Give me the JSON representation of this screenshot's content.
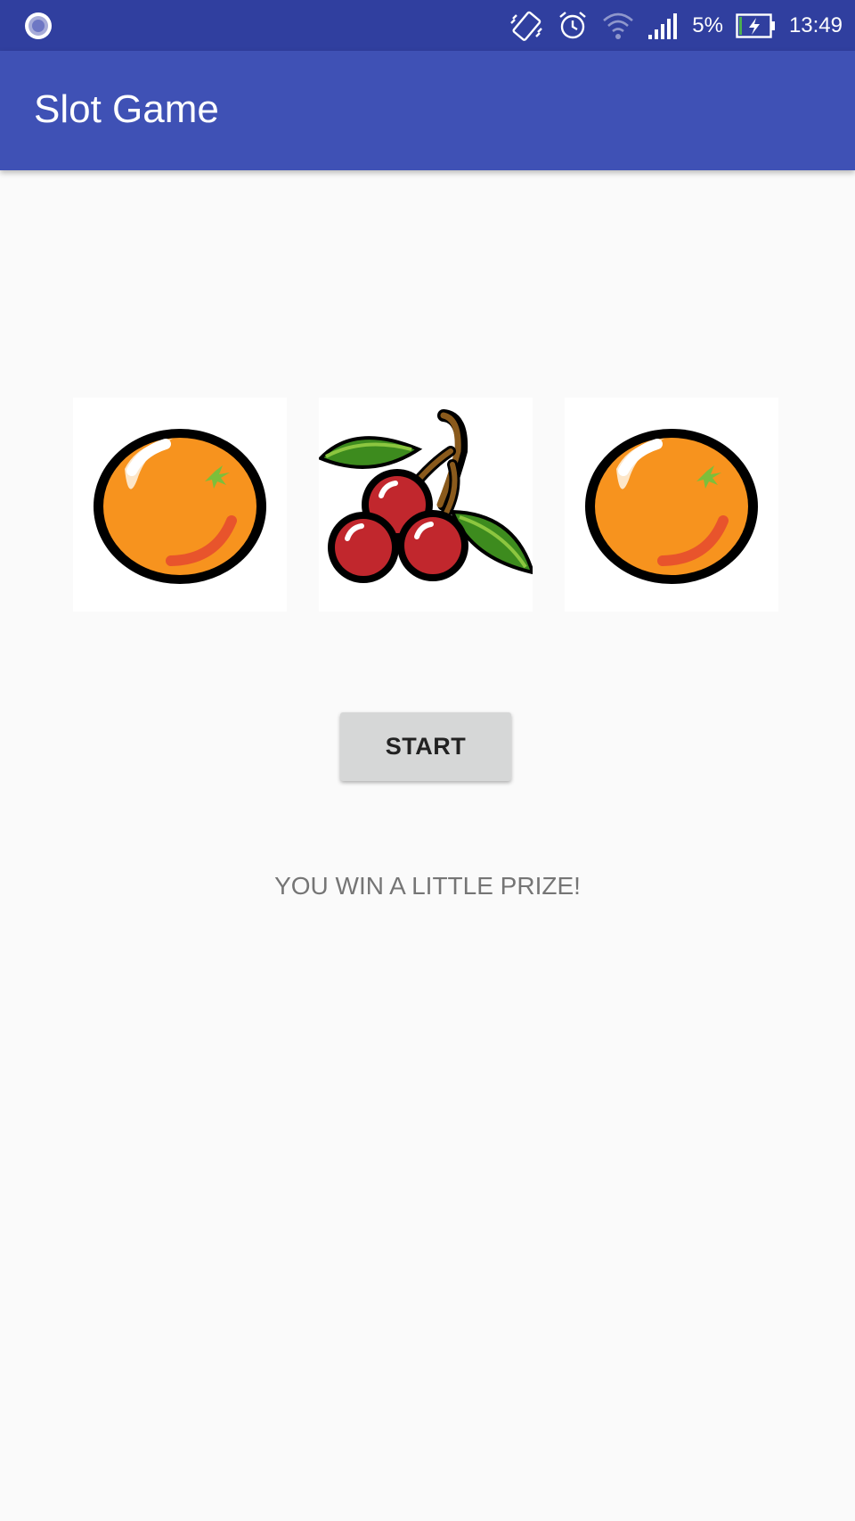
{
  "status_bar": {
    "battery_percent": "5%",
    "time": "13:49",
    "icons": [
      "notification-circle-icon",
      "vibrate-icon",
      "alarm-icon",
      "wifi-icon",
      "signal-icon",
      "battery-charging-icon"
    ]
  },
  "app_bar": {
    "title": "Slot Game"
  },
  "reels": [
    {
      "symbol": "orange-icon"
    },
    {
      "symbol": "cherry-icon"
    },
    {
      "symbol": "orange-icon"
    }
  ],
  "controls": {
    "start_label": "START"
  },
  "result": {
    "message": "YOU WIN A LITTLE PRIZE!"
  },
  "colors": {
    "status_bar": "#303f9f",
    "app_bar": "#3f51b5",
    "background": "#fafafa",
    "button": "#d6d7d7",
    "result_text": "#757575"
  }
}
